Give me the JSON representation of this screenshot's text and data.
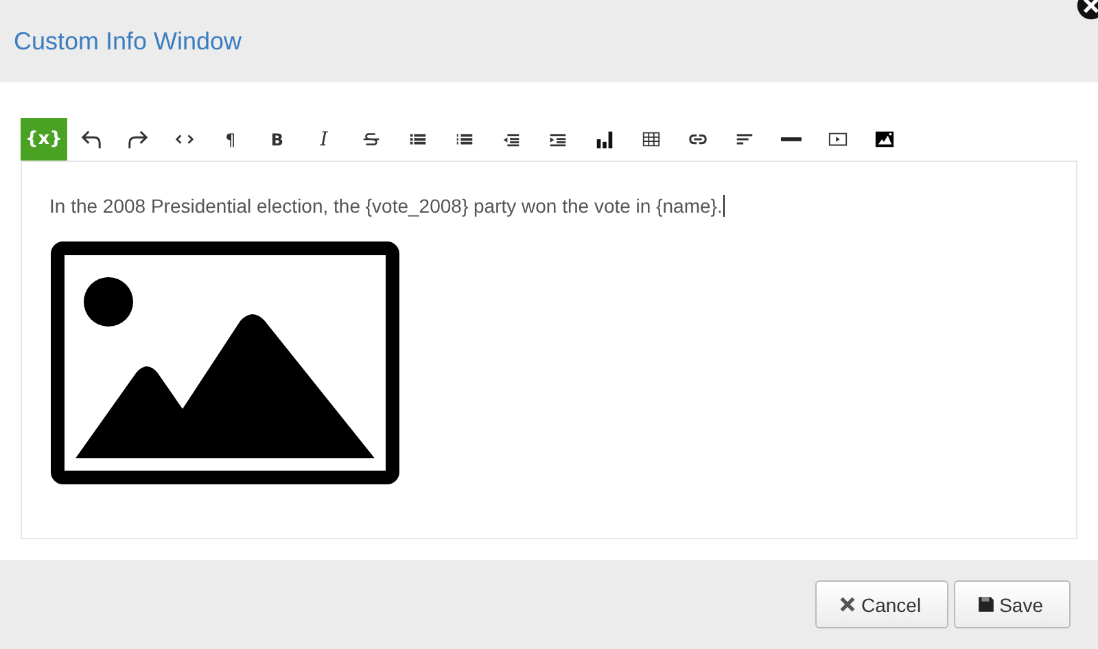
{
  "dialog": {
    "title": "Custom Info Window"
  },
  "toolbar": [
    {
      "kind": "text",
      "label": "{x}",
      "selected": true
    },
    {
      "kind": "undo",
      "selected": false
    },
    {
      "kind": "redo",
      "selected": false
    },
    {
      "kind": "code",
      "selected": false
    },
    {
      "kind": "text",
      "label": "¶",
      "selected": false
    },
    {
      "kind": "bold",
      "label": "B",
      "selected": false
    },
    {
      "kind": "italic",
      "label": "I",
      "selected": false
    },
    {
      "kind": "strike",
      "selected": false
    },
    {
      "kind": "bullets",
      "selected": false
    },
    {
      "kind": "numbers",
      "selected": false
    },
    {
      "kind": "outdent",
      "selected": false
    },
    {
      "kind": "indent",
      "selected": false
    },
    {
      "kind": "chart",
      "selected": false
    },
    {
      "kind": "table",
      "selected": false
    },
    {
      "kind": "link",
      "selected": false
    },
    {
      "kind": "align",
      "selected": false
    },
    {
      "kind": "rule",
      "selected": false
    },
    {
      "kind": "video",
      "selected": false
    },
    {
      "kind": "image",
      "selected": false
    }
  ],
  "editor": {
    "text": "In the 2008 Presidential election, the {vote_2008} party won the vote in {name}."
  },
  "buttons": [
    {
      "kind": "cancel",
      "label": "Cancel"
    },
    {
      "kind": "save",
      "label": "Save"
    }
  ]
}
